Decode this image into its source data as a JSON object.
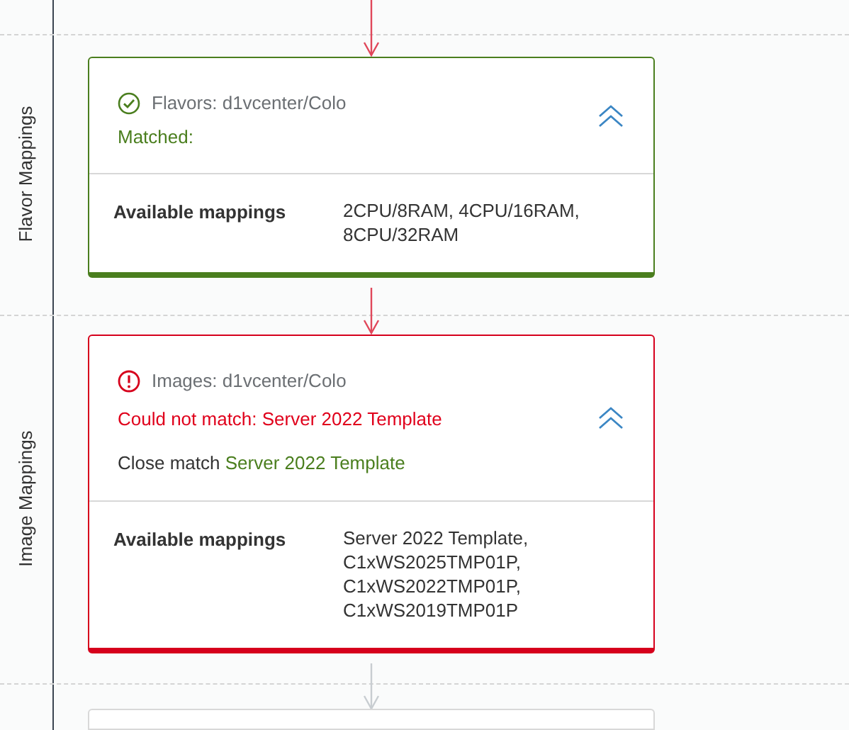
{
  "arrows": [
    {
      "active": true
    },
    {
      "active": true
    },
    {
      "active": false
    }
  ],
  "sections": [
    {
      "label": "Flavor Mappings",
      "card": {
        "matched": true,
        "title": "Flavors: d1vcenter/Colo",
        "lines": [
          {
            "kind": "matched",
            "text": "Matched:"
          }
        ],
        "expanded": true,
        "mapping_label": "Available mappings",
        "mapping_value": "2CPU/8RAM, 4CPU/16RAM, 8CPU/32RAM"
      }
    },
    {
      "label": "Image Mappings",
      "card": {
        "matched": false,
        "title": "Images: d1vcenter/Colo",
        "lines": [
          {
            "kind": "error",
            "text": "Could not match: Server 2022 Template"
          },
          {
            "kind": "close",
            "label": "Close match",
            "value": "Server 2022 Template"
          }
        ],
        "expanded": true,
        "mapping_label": "Available mappings",
        "mapping_value": "Server 2022 Template, C1xWS2025TMP01P, C1xWS2022TMP01P, C1xWS2019TMP01P"
      }
    }
  ]
}
